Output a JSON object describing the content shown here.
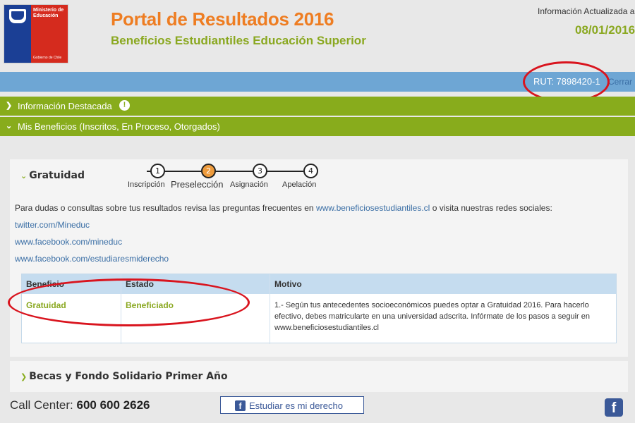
{
  "header": {
    "logo": {
      "ministry": "Ministerio de Educación",
      "government": "Gobierno de Chile"
    },
    "title": "Portal de Resultados 2016",
    "subtitle": "Beneficios Estudiantiles Educación Superior",
    "updated_label": "Información Actualizada a:",
    "updated_date": "08/01/2016"
  },
  "userbar": {
    "rut": "RUT: 7898420-1",
    "logout": "Cerrar"
  },
  "accordion": {
    "info": {
      "label": "Información Destacada",
      "icon": "exclamation-icon"
    },
    "benefits": {
      "label": "Mis Beneficios (Inscritos, En Proceso, Otorgados)"
    }
  },
  "gratuidad": {
    "title": "Gratuidad",
    "steps": [
      {
        "num": "1",
        "label": "Inscripción"
      },
      {
        "num": "2",
        "label": "Preselección"
      },
      {
        "num": "3",
        "label": "Asignación"
      },
      {
        "num": "4",
        "label": "Apelación"
      }
    ],
    "active_step": 2,
    "consult_prefix": "Para dudas o consultas sobre tus resultados revisa las preguntas frecuentes en",
    "consult_link": "www.beneficiosestudiantiles.cl",
    "consult_suffix": "o visita nuestras redes sociales:",
    "social": [
      "twitter.com/Mineduc",
      "www.facebook.com/mineduc",
      "www.facebook.com/estudiaresmiderecho"
    ],
    "table": {
      "headers": [
        "Beneficio",
        "Estado",
        "Motivo"
      ],
      "row": {
        "beneficio": "Gratuidad",
        "estado": "Beneficiado",
        "motivo": "1.- Según tus antecedentes socioeconómicos puedes optar a Gratuidad 2016. Para hacerlo efectivo, debes matricularte en una universidad adscrita. Infórmate de los pasos a seguir en www.beneficiosestudiantiles.cl"
      }
    }
  },
  "becas": {
    "title": "Becas y Fondo Solidario Primer Año"
  },
  "footer": {
    "call_label": "Call Center:",
    "call_number": "600 600 2626",
    "fb_button": "Estudiar es mi derecho"
  },
  "colors": {
    "orange": "#ee7d22",
    "green": "#88ac1c",
    "blue": "#6ea6d4",
    "annotation_red": "#d9141e"
  }
}
